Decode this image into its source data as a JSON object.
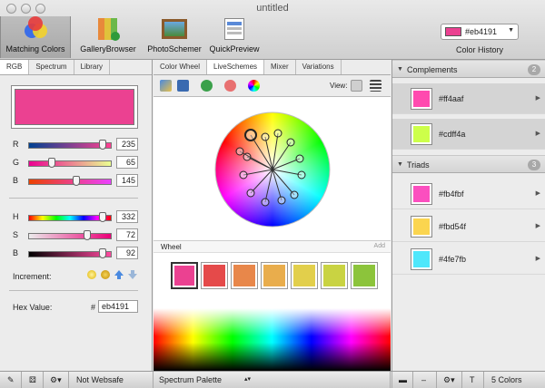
{
  "window": {
    "title": "untitled"
  },
  "toolbar": {
    "items": [
      {
        "label": "Matching Colors"
      },
      {
        "label": "GalleryBrowser"
      },
      {
        "label": "PhotoSchemer"
      },
      {
        "label": "QuickPreview"
      }
    ],
    "history": {
      "value": "#eb4191",
      "swatch": "#eb4191",
      "label": "Color History"
    }
  },
  "left": {
    "tabs": [
      "RGB",
      "Spectrum",
      "Library"
    ],
    "swatch": "#eb4191",
    "rgb": [
      {
        "label": "R",
        "value": "235",
        "fraction": 0.92
      },
      {
        "label": "G",
        "value": "65",
        "fraction": 0.25
      },
      {
        "label": "B",
        "value": "145",
        "fraction": 0.57
      }
    ],
    "hsb": [
      {
        "label": "H",
        "value": "332",
        "fraction": 0.92
      },
      {
        "label": "S",
        "value": "72",
        "fraction": 0.72
      },
      {
        "label": "B",
        "value": "92",
        "fraction": 0.92
      }
    ],
    "increment_label": "Increment:",
    "hex_label": "Hex Value:",
    "hash": "#",
    "hex_value": "eb4191"
  },
  "middle": {
    "tabs": [
      "Color Wheel",
      "LiveSchemes",
      "Mixer",
      "Variations"
    ],
    "view_label": "View:",
    "section_title": "Wheel",
    "add_label": "Add",
    "chips": [
      "#eb4191",
      "#e54a4a",
      "#e8874a",
      "#e9ad4c",
      "#e2cf4b",
      "#c9d342",
      "#8cc43b"
    ]
  },
  "right": {
    "groups": [
      {
        "title": "Complements",
        "count": "2",
        "items": [
          {
            "hex": "#ff4aaf",
            "color": "#ff4aaf"
          },
          {
            "hex": "#cdff4a",
            "color": "#cdff4a"
          }
        ]
      },
      {
        "title": "Triads",
        "count": "3",
        "items": [
          {
            "hex": "#fb4fbf",
            "color": "#fb4fbf"
          },
          {
            "hex": "#fbd54f",
            "color": "#fbd54f"
          },
          {
            "hex": "#4fe7fb",
            "color": "#4fe7fb"
          }
        ]
      }
    ]
  },
  "bottom": {
    "websafe": "Not Websafe",
    "palette": "Spectrum Palette",
    "count": "5 Colors"
  }
}
